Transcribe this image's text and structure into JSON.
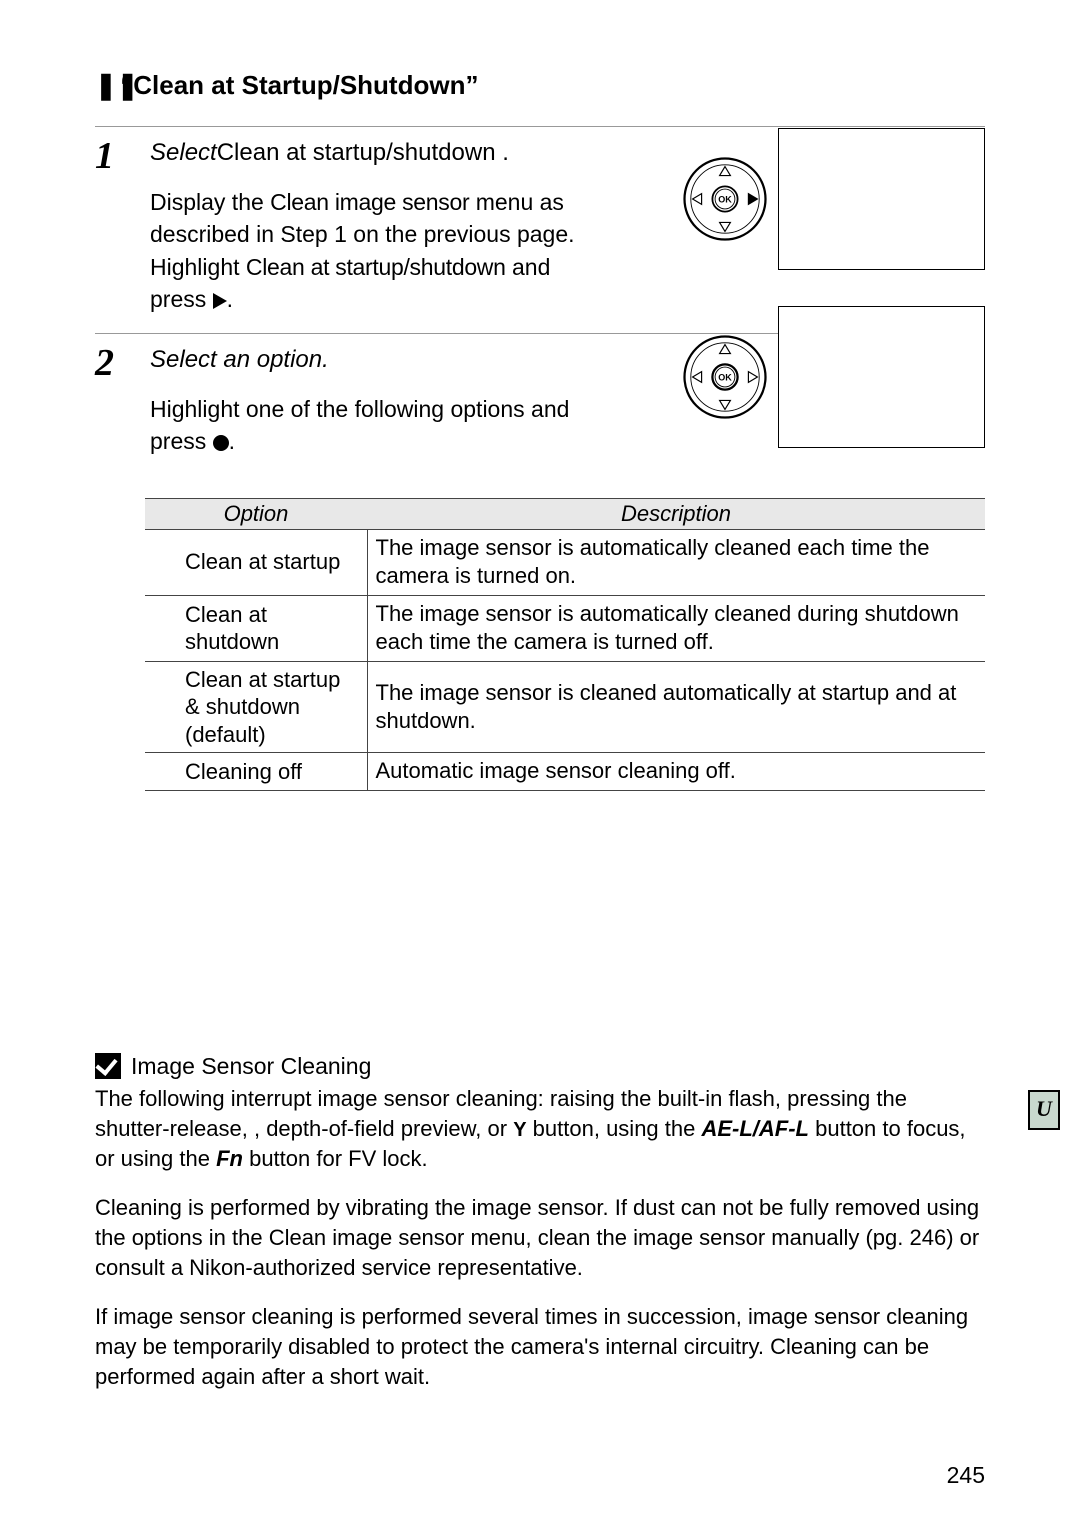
{
  "heading": {
    "icon": "❚❚",
    "text": "“Clean at Startup/Shutdown”"
  },
  "steps": [
    {
      "num": "1",
      "title_italic": "Select",
      "title_rest": "Clean at startup/shutdown .",
      "body_pre": "Display the ",
      "body_cond1": "Clean image sensor",
      "body_mid": " menu as described in Step 1 on the previous page.  Highlight ",
      "body_cond2": "Clean at startup/shutdown",
      "body_post": " and press ",
      "dpad_highlight": "right"
    },
    {
      "num": "2",
      "title_italic": "Select an option.",
      "title_rest": "",
      "body_pre": "Highlight one of the following options and press ",
      "body_cond1": "",
      "body_mid": "",
      "body_cond2": "",
      "body_post": "",
      "dpad_highlight": "center"
    }
  ],
  "table": {
    "h1": "Option",
    "h2": "Description",
    "rows": [
      {
        "opt": "Clean at startup",
        "desc": "The image sensor is automatically cleaned each time the camera is turned on."
      },
      {
        "opt": "Clean at shutdown",
        "desc": "The image sensor is automatically cleaned during shutdown each time the camera is turned off."
      },
      {
        "opt": "Clean at startup & shutdown (default)",
        "desc": "The image sensor is cleaned automatically at startup and at shutdown."
      },
      {
        "opt": "Cleaning off",
        "desc": "Automatic image sensor cleaning off."
      }
    ]
  },
  "note": {
    "title": "Image Sensor Cleaning",
    "p1a": "The following interrupt image sensor cleaning: raising the built-in flash, pressing the shutter-release,    , depth-of-field preview, or ",
    "p1_icon": "Y",
    "p1b": " button, using the ",
    "p1_bi": "AE-L/AF-L",
    "p1c": " button to focus, or using the ",
    "p1_fn": "Fn",
    "p1d": " button for FV lock.",
    "p2a": "Cleaning is performed by vibrating the image sensor.  If dust can not be fully removed using the options in the ",
    "p2_cond": "Clean image sensor",
    "p2b": " menu, clean the image sensor manually (pg. 246) or consult a Nikon-authorized service representative.",
    "p3": "If image sensor cleaning is performed several times in succession, image sensor cleaning may be temporarily disabled to protect the camera's internal circuitry.  Cleaning can be performed again after a short wait."
  },
  "side_tab": "U",
  "page_number": "245"
}
